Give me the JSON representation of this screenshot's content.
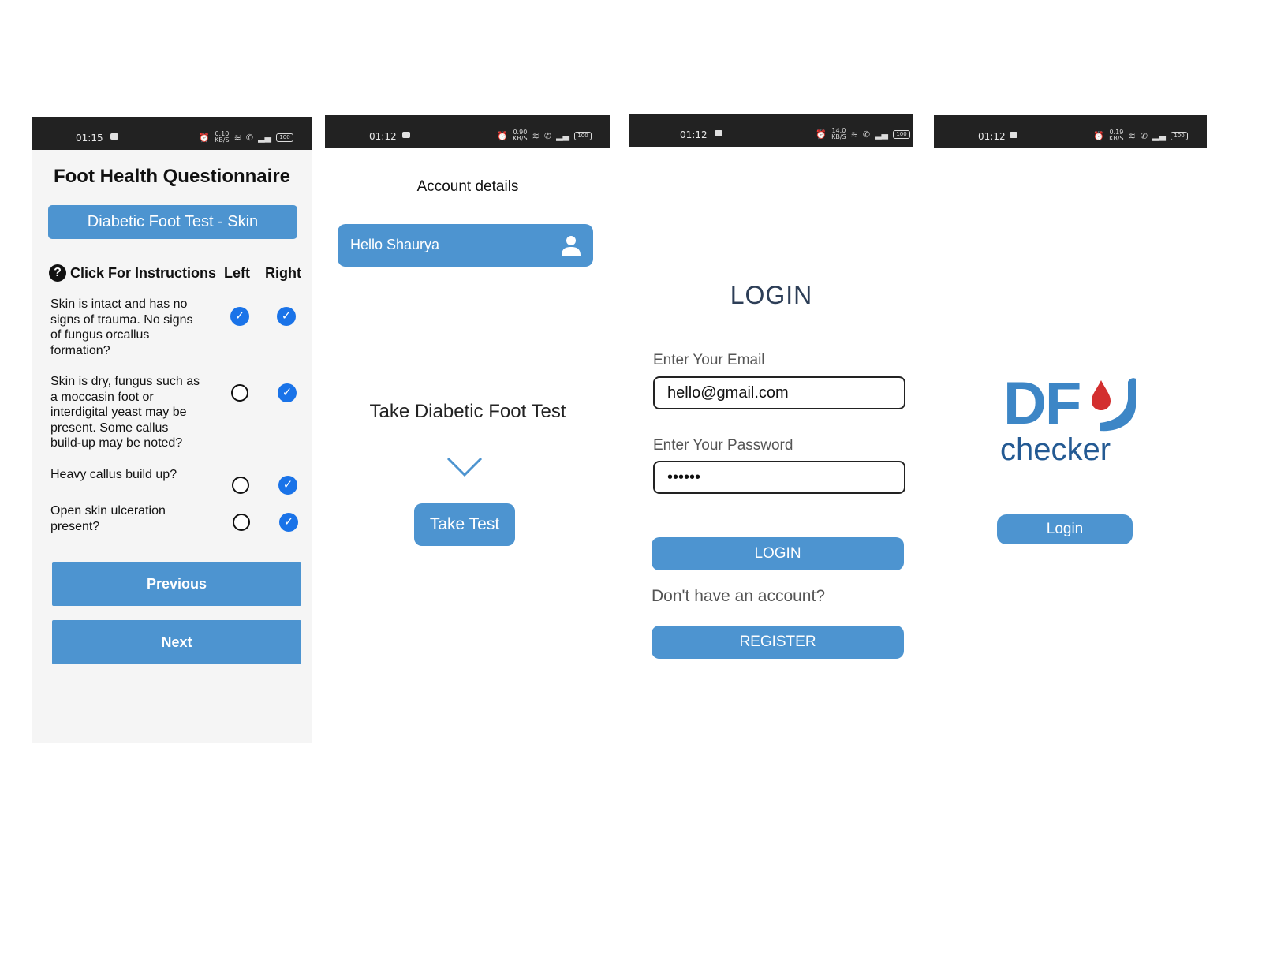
{
  "screens": {
    "questionnaire": {
      "status": {
        "time": "01:15",
        "net": "0.10\nKB/S",
        "battery": "100"
      },
      "title": "Foot Health Questionnaire",
      "section_banner": "Diabetic Foot Test - Skin",
      "instructions_label": "Click For Instructions",
      "help_icon": "?",
      "col_left": "Left",
      "col_right": "Right",
      "questions": [
        {
          "text": "Skin is intact and has no signs of trauma. No signs of fungus orcallus formation?",
          "left": true,
          "right": true
        },
        {
          "text": "Skin is dry, fungus such as a moccasin foot or interdigital yeast may be present. Some callus build-up may be noted?",
          "left": false,
          "right": true
        },
        {
          "text": "Heavy callus build up?",
          "left": false,
          "right": true
        },
        {
          "text": "Open skin ulceration present?",
          "left": false,
          "right": true
        }
      ],
      "check_glyph": "✓",
      "previous_label": "Previous",
      "next_label": "Next"
    },
    "account": {
      "status": {
        "time": "01:12",
        "net": "0.90\nKB/S",
        "battery": "100"
      },
      "title": "Account details",
      "greeting": "Hello Shaurya",
      "user_icon": "user-icon",
      "take_heading": "Take Diabetic Foot Test",
      "take_button": "Take Test"
    },
    "login": {
      "status": {
        "time": "01:12",
        "net": "14.0\nKB/S",
        "battery": "100"
      },
      "title": "LOGIN",
      "email_label": "Enter Your Email",
      "email_value": "hello@gmail.com",
      "password_label": "Enter Your Password",
      "password_value": "••••••",
      "login_button": "LOGIN",
      "no_account": "Don't have an account?",
      "register_button": "REGISTER"
    },
    "splash": {
      "status": {
        "time": "01:12",
        "net": "0.19\nKB/S",
        "battery": "100"
      },
      "logo_df": "DF",
      "logo_checker": "checker",
      "login_button": "Login"
    }
  },
  "colors": {
    "primary": "#4d94d0",
    "check_blue": "#1a73e8",
    "status_bar": "#222222",
    "logo_blue": "#3d86c6",
    "logo_dark": "#245a93",
    "drop_red": "#d32f2f"
  }
}
